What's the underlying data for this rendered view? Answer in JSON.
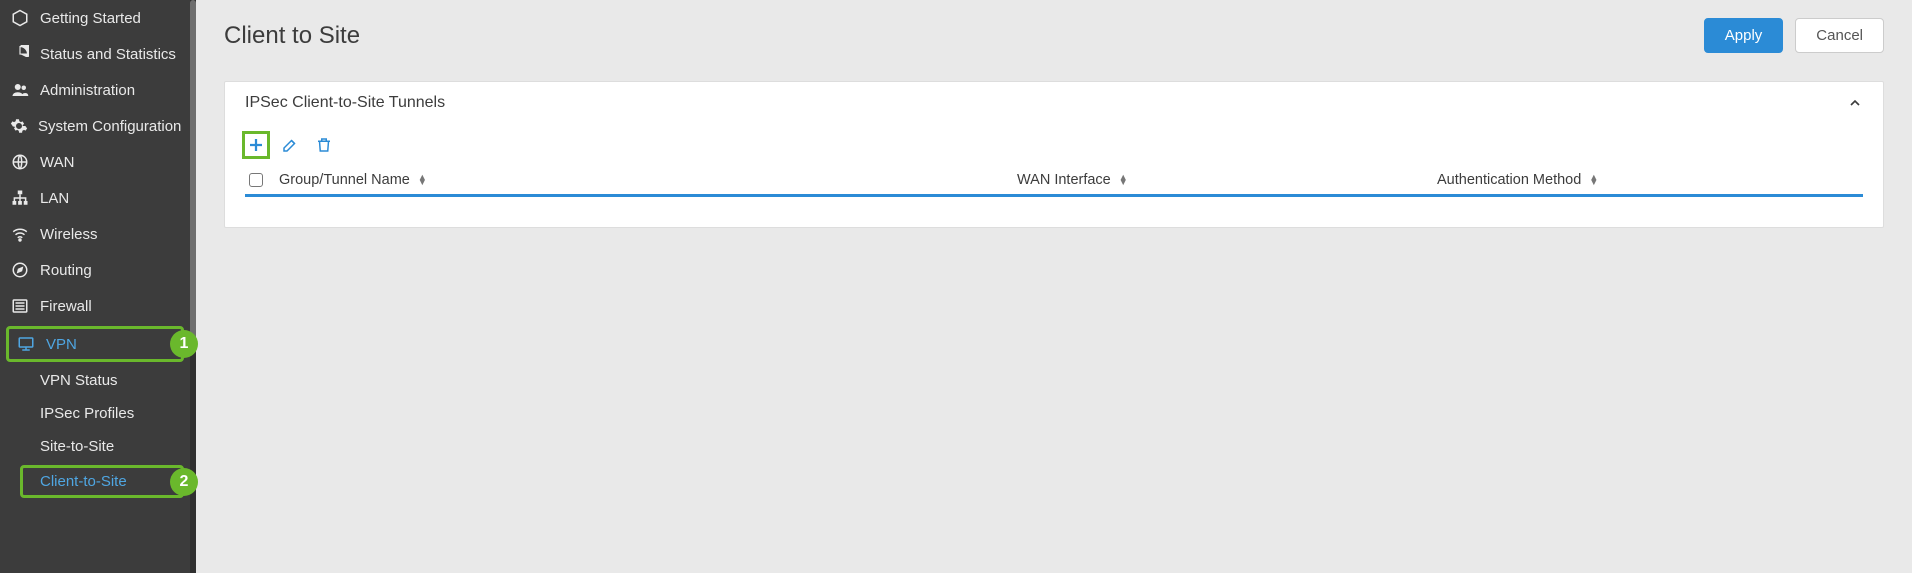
{
  "sidebar": {
    "items": [
      {
        "icon": "hexagon-icon",
        "label": "Getting Started"
      },
      {
        "icon": "pie-icon",
        "label": "Status and Statistics"
      },
      {
        "icon": "users-icon",
        "label": "Administration"
      },
      {
        "icon": "gear-icon",
        "label": "System Configuration"
      },
      {
        "icon": "globe-icon",
        "label": "WAN"
      },
      {
        "icon": "sitemap-icon",
        "label": "LAN"
      },
      {
        "icon": "wifi-icon",
        "label": "Wireless"
      },
      {
        "icon": "compass-icon",
        "label": "Routing"
      },
      {
        "icon": "list-icon",
        "label": "Firewall"
      },
      {
        "icon": "display-icon",
        "label": "VPN",
        "active": true,
        "highlight": true,
        "badge": "1"
      }
    ],
    "sub_items": [
      {
        "label": "VPN Status"
      },
      {
        "label": "IPSec Profiles"
      },
      {
        "label": "Site-to-Site"
      },
      {
        "label": "Client-to-Site",
        "active": true,
        "highlight": true,
        "badge": "2"
      }
    ]
  },
  "page": {
    "title": "Client to Site",
    "apply_label": "Apply",
    "cancel_label": "Cancel"
  },
  "panel": {
    "title": "IPSec Client-to-Site Tunnels",
    "columns": {
      "group_tunnel": "Group/Tunnel Name",
      "wan_interface": "WAN Interface",
      "auth_method": "Authentication Method"
    }
  },
  "annotations": {
    "badge1": "1",
    "badge2": "2"
  }
}
